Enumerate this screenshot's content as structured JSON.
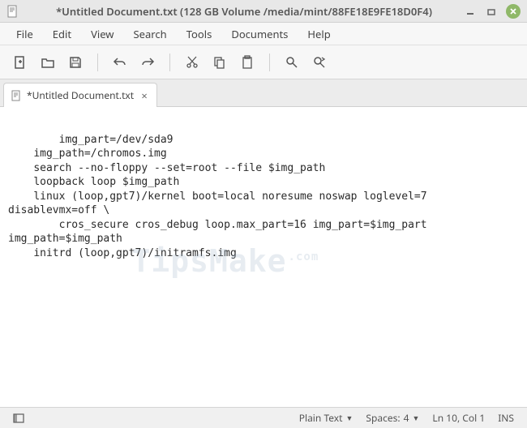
{
  "titlebar": {
    "title": "*Untitled Document.txt (128 GB Volume /media/mint/88FE18E9FE18D0F4)"
  },
  "menubar": {
    "items": [
      "File",
      "Edit",
      "View",
      "Search",
      "Tools",
      "Documents",
      "Help"
    ]
  },
  "tab": {
    "label": "*Untitled Document.txt",
    "close": "×"
  },
  "editor": {
    "content": "    img_part=/dev/sda9\n    img_path=/chromos.img\n    search --no-floppy --set=root --file $img_path\n    loopback loop $img_path\n    linux (loop,gpt7)/kernel boot=local noresume noswap loglevel=7 disablevmx=off \\\n        cros_secure cros_debug loop.max_part=16 img_part=$img_part img_path=$img_path\n    initrd (loop,gpt7)/initramfs.img"
  },
  "statusbar": {
    "language": "Plain Text",
    "spaces_label": "Spaces:",
    "spaces_value": "4",
    "position": "Ln 10, Col 1",
    "mode": "INS"
  },
  "watermark": {
    "main": "TipsMake",
    "suffix": ".com"
  }
}
